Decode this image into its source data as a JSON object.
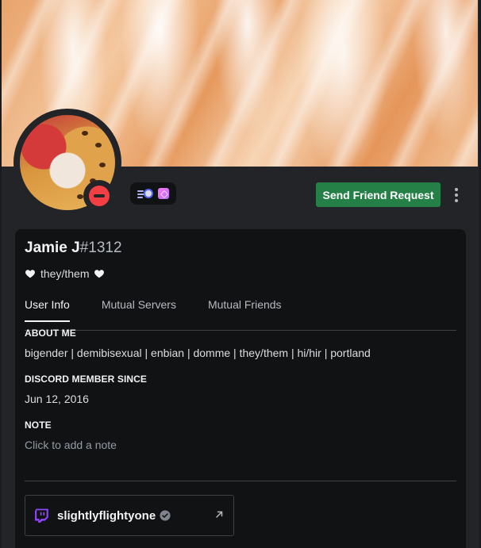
{
  "profile": {
    "username": "Jamie J",
    "discriminator": "#1312",
    "pronouns": "they/them",
    "status": "do-not-disturb",
    "badges": [
      "hypesquad-speed-badge",
      "nitro-badge"
    ]
  },
  "actions": {
    "friend_request_label": "Send Friend Request"
  },
  "tabs": [
    {
      "label": "User Info",
      "active": true
    },
    {
      "label": "Mutual Servers",
      "active": false
    },
    {
      "label": "Mutual Friends",
      "active": false
    }
  ],
  "about_me": {
    "title": "ABOUT ME",
    "text": "bigender | demibisexual | enbian | domme | they/them | hi/hir | portland"
  },
  "member_since": {
    "title": "DISCORD MEMBER SINCE",
    "date": "Jun 12, 2016"
  },
  "note": {
    "title": "NOTE",
    "placeholder": "Click to add a note"
  },
  "connection": {
    "platform": "twitch",
    "name": "slightlyflightyone",
    "verified": true
  },
  "colors": {
    "accent_green": "#248046",
    "dnd_red": "#f23f43",
    "twitch_purple": "#9146ff"
  }
}
